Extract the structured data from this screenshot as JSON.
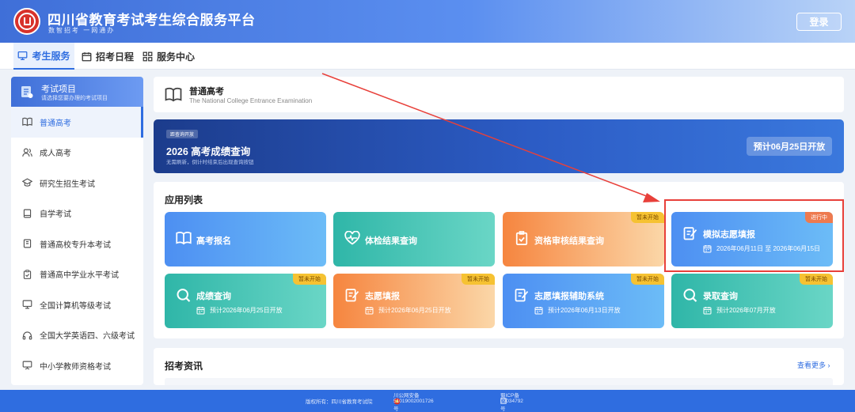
{
  "header": {
    "title": "四川省教育考试考生综合服务平台",
    "subtitle": "数智招考 一网通办",
    "login_label": "登录"
  },
  "nav": [
    {
      "label": "考生服务",
      "icon": "monitor-icon",
      "active": true
    },
    {
      "label": "招考日程",
      "icon": "calendar-icon",
      "active": false
    },
    {
      "label": "服务中心",
      "icon": "grid-icon",
      "active": false
    }
  ],
  "sidebar": {
    "title": "考试项目",
    "subtitle": "请选择您要办理的考试项目",
    "items": [
      {
        "label": "普通高考",
        "icon": "book-icon",
        "active": true
      },
      {
        "label": "成人高考",
        "icon": "users-icon"
      },
      {
        "label": "研究生招生考试",
        "icon": "graduation-cap-icon"
      },
      {
        "label": "自学考试",
        "icon": "notebook-icon"
      },
      {
        "label": "普通高校专升本考试",
        "icon": "document-icon"
      },
      {
        "label": "普通高中学业水平考试",
        "icon": "clipboard-check-icon"
      },
      {
        "label": "全国计算机等级考试",
        "icon": "monitor-icon"
      },
      {
        "label": "全国大学英语四、六级考试",
        "icon": "headphones-icon"
      },
      {
        "label": "中小学教师资格考试",
        "icon": "presentation-icon"
      }
    ]
  },
  "exam": {
    "title": "普通高考",
    "subtitle": "The National College Entrance Examination"
  },
  "banner": {
    "tag": "距查询开放",
    "title": "2026 高考成绩查询",
    "subtitle": "无需刷新，倒计时结束后出现查询按钮",
    "button": "预计06月25日开放"
  },
  "apps": {
    "title": "应用列表",
    "items": [
      {
        "name": "高考报名",
        "icon": "book-icon",
        "color": "blue",
        "badge": "",
        "date": ""
      },
      {
        "name": "体检结果查询",
        "icon": "heartbeat-icon",
        "color": "teal",
        "badge": "",
        "date": ""
      },
      {
        "name": "资格审核结果查询",
        "icon": "clipboard-check-icon",
        "color": "orange",
        "badge": "暂未开始",
        "date": ""
      },
      {
        "name": "模拟志愿填报",
        "icon": "edit-note-icon",
        "color": "blue",
        "badge": "进行中",
        "date": "2026年06月11日 至 2026年06月15日"
      },
      {
        "name": "成绩查询",
        "icon": "search-icon",
        "color": "teal",
        "badge": "暂未开始",
        "date": "预计2026年06月25日开放"
      },
      {
        "name": "志愿填报",
        "icon": "edit-note-icon",
        "color": "orange",
        "badge": "暂未开始",
        "date": "预计2026年06月25日开放"
      },
      {
        "name": "志愿填报辅助系统",
        "icon": "edit-note-icon",
        "color": "blue",
        "badge": "暂未开始",
        "date": "预计2026年06月13日开放"
      },
      {
        "name": "录取查询",
        "icon": "search-icon",
        "color": "teal",
        "badge": "暂未开始",
        "date": "预计2026年07月开放"
      }
    ]
  },
  "news": {
    "title": "招考资讯",
    "more": "查看更多"
  },
  "footer": {
    "copyright": "版权所有：四川省教育考试院",
    "police": "川公网安备 51019002001726号",
    "icp": "蜀ICP备09034792号"
  },
  "colors": {
    "primary": "#2f6de0",
    "highlight_box": "#e8403a",
    "badge_pending": "#f6c232",
    "badge_running": "#ee7a4f"
  }
}
